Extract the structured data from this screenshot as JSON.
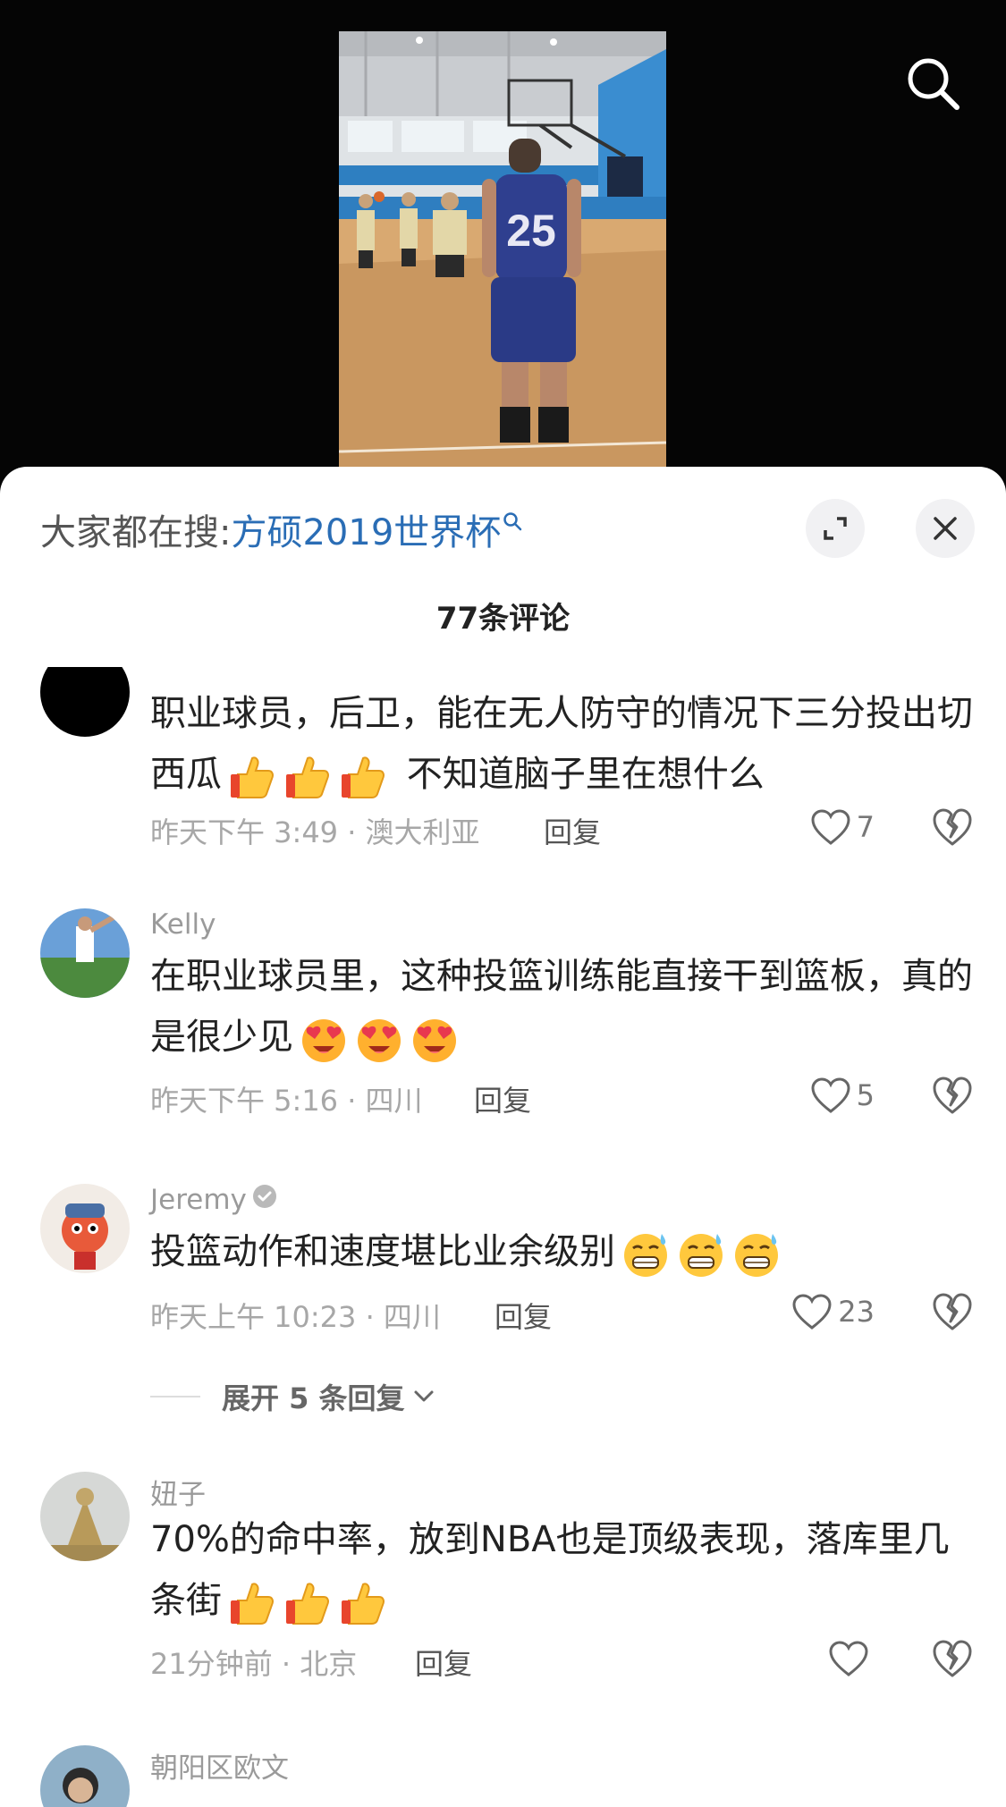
{
  "video": {
    "jersey_number": "25"
  },
  "sheet": {
    "hot_search_label": "大家都在搜:",
    "hot_search_term": "方硕2019世界杯",
    "comment_count": "77条评论"
  },
  "comments": [
    {
      "username": "",
      "text_before": "职业球员，后卫，能在无人防守的情况下三分投出切西瓜",
      "emoji": "thumbs-up",
      "emoji_count": 3,
      "text_after": " 不知道脑子里在想什么",
      "time_location": "昨天下午 3:49 · 澳大利亚",
      "reply_label": "回复",
      "likes": "7"
    },
    {
      "username": "Kelly",
      "text_before": "在职业球员里，这种投篮训练能直接干到篮板，真的是很少见",
      "emoji": "heart-eyes",
      "emoji_count": 3,
      "text_after": "",
      "time_location": "昨天下午 5:16 · 四川",
      "reply_label": "回复",
      "likes": "5"
    },
    {
      "username": "Jeremy",
      "verified": true,
      "text_before": "投篮动作和速度堪比业余级别",
      "emoji": "grimace-sweat",
      "emoji_count": 3,
      "text_after": "",
      "time_location": "昨天上午 10:23 · 四川",
      "reply_label": "回复",
      "likes": "23"
    },
    {
      "username": "妞子",
      "text_before": "70%的命中率，放到NBA也是顶级表现，落库里几条街",
      "emoji": "thumbs-up",
      "emoji_count": 3,
      "text_after": "",
      "time_location": "21分钟前 · 北京",
      "reply_label": "回复",
      "likes": ""
    },
    {
      "username": "朝阳区欧文"
    }
  ],
  "expand_replies_label": "展开 5 条回复",
  "colors": {
    "accent_link": "#2a6db5",
    "emoji_yellow": "#ffc83d",
    "heart_eyes_red": "#e8384f"
  }
}
